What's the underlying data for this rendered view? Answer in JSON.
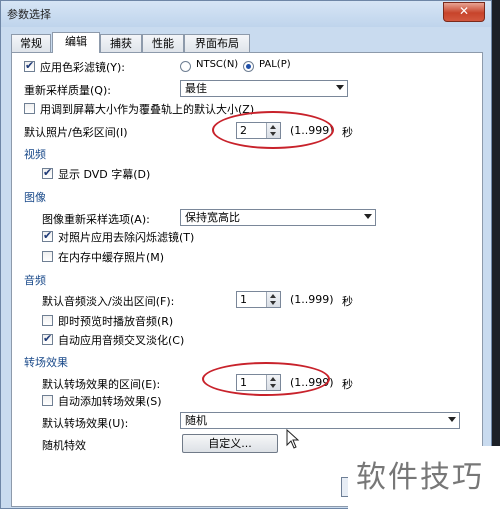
{
  "window": {
    "title": "参数选择",
    "close_label": "✕"
  },
  "tabs": [
    {
      "label": "常规",
      "active": false
    },
    {
      "label": "编辑",
      "active": true
    },
    {
      "label": "捕获",
      "active": false
    },
    {
      "label": "性能",
      "active": false
    },
    {
      "label": "界面布局",
      "active": false
    }
  ],
  "edit": {
    "color_filter": {
      "label": "应用色彩滤镜(Y):",
      "checked": true
    },
    "ntsc": {
      "label": "NTSC(N)",
      "selected": false
    },
    "pal": {
      "label": "PAL(P)",
      "selected": true
    },
    "resample_quality": {
      "label": "重新采样质量(Q):",
      "value": "最佳"
    },
    "fit_overlay": {
      "label": "用调到屏幕大小作为覆叠轨上的默认大小(Z)",
      "checked": false
    },
    "photo_interval": {
      "label": "默认照片/色彩区间(I)",
      "value": "2",
      "range": "(1..999)",
      "unit": "秒"
    }
  },
  "video": {
    "title": "视频",
    "dvd_subtitles": {
      "label": "显示 DVD 字幕(D)",
      "checked": true
    }
  },
  "image": {
    "title": "图像",
    "resample_option": {
      "label": "图像重新采样选项(A):",
      "value": "保持宽高比"
    },
    "flicker_filter": {
      "label": "对照片应用去除闪烁滤镜(T)",
      "checked": true
    },
    "cache_photos": {
      "label": "在内存中缓存照片(M)",
      "checked": false
    }
  },
  "audio": {
    "title": "音频",
    "fade_interval": {
      "label": "默认音频淡入/淡出区间(F):",
      "value": "1",
      "range": "(1..999)",
      "unit": "秒"
    },
    "instant_preview": {
      "label": "即时预览时播放音频(R)",
      "checked": false
    },
    "auto_crossfade": {
      "label": "自动应用音频交叉淡化(C)",
      "checked": true
    }
  },
  "transition": {
    "title": "转场效果",
    "interval": {
      "label": "默认转场效果的区间(E):",
      "value": "1",
      "range": "(1..999)",
      "unit": "秒"
    },
    "auto_add": {
      "label": "自动添加转场效果(S)",
      "checked": false
    },
    "default_effect": {
      "label": "默认转场效果(U):",
      "value": "随机"
    },
    "random_effects": {
      "label": "随机特效",
      "button_label": "自定义..."
    }
  },
  "watermark": {
    "text": "软件技巧"
  },
  "colors": {
    "highlight_circle": "#c8222b",
    "window_bg": "#c9dbef",
    "close_red": "#c7442b"
  }
}
